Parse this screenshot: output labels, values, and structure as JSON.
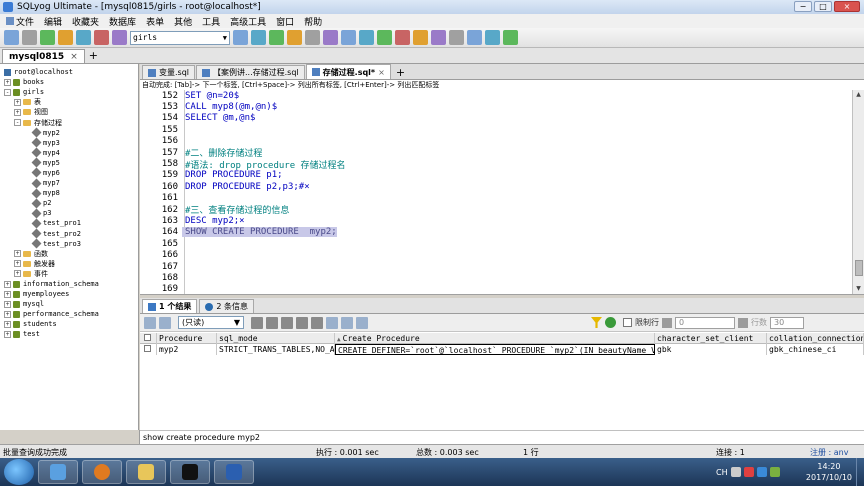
{
  "window": {
    "title": "SQLyog Ultimate - [mysql0815/girls - root@localhost*]"
  },
  "menu": [
    "文件",
    "编辑",
    "收藏夹",
    "数据库",
    "表单",
    "其他",
    "工具",
    "高级工具",
    "窗口",
    "帮助"
  ],
  "toolbar": {
    "database": "girls"
  },
  "connection_tab": {
    "label": "mysql0815",
    "close": "×"
  },
  "tree": {
    "rows": [
      {
        "level": 0,
        "expander": "",
        "icon": "server",
        "label": "root@localhost"
      },
      {
        "level": 0,
        "expander": "+",
        "icon": "db",
        "label": "books"
      },
      {
        "level": 0,
        "expander": "-",
        "icon": "db",
        "label": "girls"
      },
      {
        "level": 1,
        "expander": "+",
        "icon": "folder",
        "label": "表"
      },
      {
        "level": 1,
        "expander": "+",
        "icon": "folder",
        "label": "视图"
      },
      {
        "level": 1,
        "expander": "-",
        "icon": "folder",
        "label": "存储过程"
      },
      {
        "level": 2,
        "expander": "",
        "icon": "proc",
        "label": "myp2"
      },
      {
        "level": 2,
        "expander": "",
        "icon": "proc",
        "label": "myp3"
      },
      {
        "level": 2,
        "expander": "",
        "icon": "proc",
        "label": "myp4"
      },
      {
        "level": 2,
        "expander": "",
        "icon": "proc",
        "label": "myp5"
      },
      {
        "level": 2,
        "expander": "",
        "icon": "proc",
        "label": "myp6"
      },
      {
        "level": 2,
        "expander": "",
        "icon": "proc",
        "label": "myp7"
      },
      {
        "level": 2,
        "expander": "",
        "icon": "proc",
        "label": "myp8"
      },
      {
        "level": 2,
        "expander": "",
        "icon": "proc",
        "label": "p2"
      },
      {
        "level": 2,
        "expander": "",
        "icon": "proc",
        "label": "p3"
      },
      {
        "level": 2,
        "expander": "",
        "icon": "proc",
        "label": "test_pro1"
      },
      {
        "level": 2,
        "expander": "",
        "icon": "proc",
        "label": "test_pro2"
      },
      {
        "level": 2,
        "expander": "",
        "icon": "proc",
        "label": "test_pro3"
      },
      {
        "level": 1,
        "expander": "+",
        "icon": "folder",
        "label": "函数"
      },
      {
        "level": 1,
        "expander": "+",
        "icon": "folder",
        "label": "触发器"
      },
      {
        "level": 1,
        "expander": "+",
        "icon": "folder",
        "label": "事件"
      },
      {
        "level": 0,
        "expander": "+",
        "icon": "db",
        "label": "information_schema"
      },
      {
        "level": 0,
        "expander": "+",
        "icon": "db",
        "label": "myemployees"
      },
      {
        "level": 0,
        "expander": "+",
        "icon": "db",
        "label": "mysql"
      },
      {
        "level": 0,
        "expander": "+",
        "icon": "db",
        "label": "performance_schema"
      },
      {
        "level": 0,
        "expander": "+",
        "icon": "db",
        "label": "students"
      },
      {
        "level": 0,
        "expander": "+",
        "icon": "db",
        "label": "test"
      }
    ]
  },
  "editor_tabs": [
    {
      "label": "变量.sql",
      "close": ""
    },
    {
      "label": "【案例讲...存储过程.sql",
      "close": ""
    },
    {
      "label": "存储过程.sql*",
      "close": "×",
      "active": true
    }
  ],
  "editor_hint": "自动完成: [Tab]-> 下一个标签, [Ctrl+Space]-> 列出所有标签, [Ctrl+Enter]-> 列出匹配标签",
  "code_lines": [
    {
      "num": "152",
      "text": "SET @n=20$",
      "style": "kw"
    },
    {
      "num": "153",
      "text": "CALL myp8(@m,@n)$",
      "style": "kw"
    },
    {
      "num": "154",
      "text": "SELECT @m,@n$",
      "style": "kw"
    },
    {
      "num": "155",
      "text": "",
      "style": ""
    },
    {
      "num": "156",
      "text": "",
      "style": ""
    },
    {
      "num": "157",
      "text": "#二、删除存储过程",
      "style": "cm"
    },
    {
      "num": "158",
      "text": "#语法: drop procedure 存储过程名",
      "style": "cm"
    },
    {
      "num": "159",
      "text": "DROP PROCEDURE p1;",
      "style": "kw"
    },
    {
      "num": "160",
      "text": "DROP PROCEDURE p2,p3;#×",
      "style": "kw"
    },
    {
      "num": "161",
      "text": "",
      "style": ""
    },
    {
      "num": "162",
      "text": "#三、查看存储过程的信息",
      "style": "cm"
    },
    {
      "num": "163",
      "text": "DESC myp2;×",
      "style": "kw"
    },
    {
      "num": "164",
      "text": "SHOW CREATE PROCEDURE  myp2;",
      "style": "sel"
    },
    {
      "num": "165",
      "text": "",
      "style": ""
    },
    {
      "num": "166",
      "text": "",
      "style": ""
    },
    {
      "num": "167",
      "text": "",
      "style": ""
    },
    {
      "num": "168",
      "text": "",
      "style": ""
    },
    {
      "num": "169",
      "text": "",
      "style": ""
    }
  ],
  "result_tabs": [
    {
      "label": "1 个结果",
      "active": true
    },
    {
      "label": "2 条信息",
      "active": false
    }
  ],
  "result_toolbar": {
    "mode": "(只读)",
    "limit_label": "限制行",
    "first_row": "0",
    "rows_label": "行数",
    "rows_value": "30"
  },
  "grid": {
    "columns": [
      "Procedure",
      "sql_mode",
      "Create Procedure",
      "character_set_client",
      "collation_connection"
    ],
    "rows": [
      [
        "myp2",
        "STRICT_TRANS_TABLES,NO_AU",
        "CREATE DEFINER=`root`@`localhost` PROCEDURE `myp2`(IN beautyName VA",
        "gbk",
        "gbk_chinese_ci"
      ]
    ]
  },
  "query_bar": "show create procedure  myp2",
  "status": {
    "message": "批量查询成功完成",
    "exec_time": "执行 : 0.001 sec",
    "total_time": "总数 : 0.003 sec",
    "line": "1 行",
    "connections": "连接 : 1",
    "register": "注册 : anv"
  },
  "taskbar": {
    "lang": "CH",
    "time": "14:20",
    "date": "2017/10/10"
  }
}
